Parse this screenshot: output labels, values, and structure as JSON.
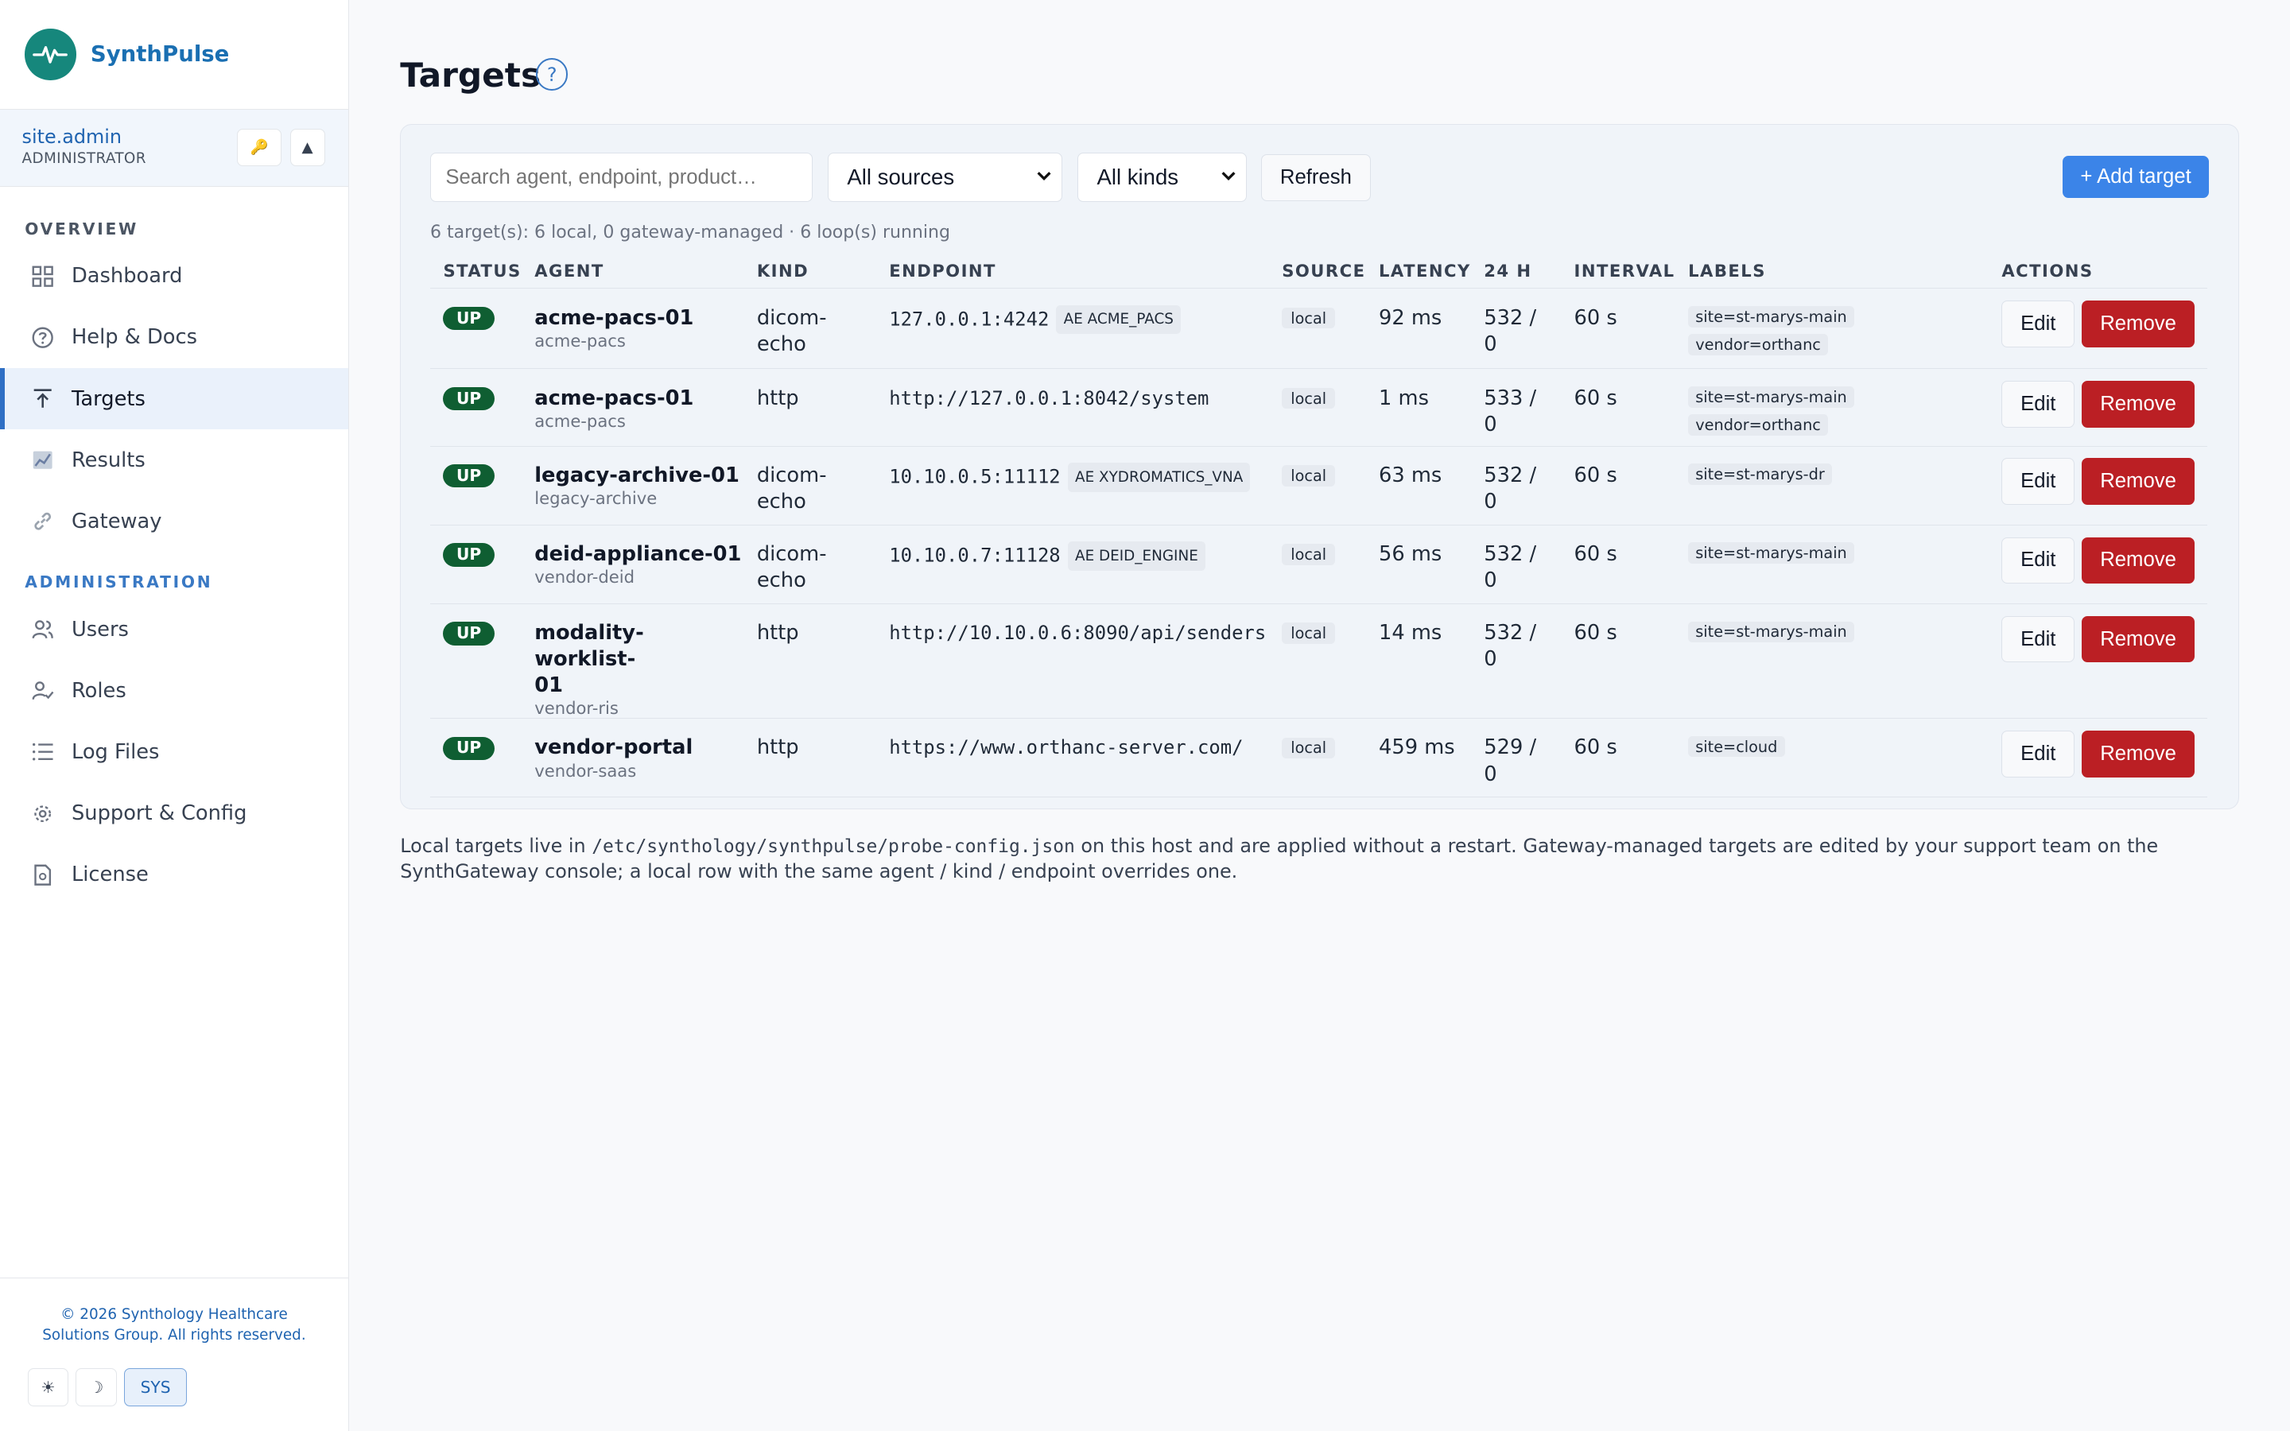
{
  "brand": {
    "name": "SynthPulse"
  },
  "user": {
    "name": "site.admin",
    "role": "ADMINISTRATOR",
    "key_icon": "🔑",
    "up_icon": "▲"
  },
  "nav": {
    "overview_label": "OVERVIEW",
    "admin_label": "ADMINISTRATION",
    "items": [
      {
        "label": "Dashboard",
        "icon": "grid-icon"
      },
      {
        "label": "Help & Docs",
        "icon": "help-circle-icon"
      },
      {
        "label": "Targets",
        "icon": "arrow-up-icon",
        "active": true
      },
      {
        "label": "Results",
        "icon": "chart-icon"
      },
      {
        "label": "Gateway",
        "icon": "link-icon"
      },
      {
        "label": "Users",
        "icon": "users-icon"
      },
      {
        "label": "Roles",
        "icon": "user-check-icon"
      },
      {
        "label": "Log Files",
        "icon": "list-icon"
      },
      {
        "label": "Support & Config",
        "icon": "settings-icon"
      },
      {
        "label": "License",
        "icon": "file-icon"
      }
    ]
  },
  "footer": {
    "copyright": "© 2026 Synthology Healthcare Solutions Group. All rights reserved.",
    "theme_light": "☀",
    "theme_dark": "☽",
    "theme_sys": "SYS"
  },
  "page": {
    "title": "Targets",
    "help": "?"
  },
  "toolbar": {
    "search_placeholder": "Search agent, endpoint, product…",
    "source_select": "All sources",
    "kind_select": "All kinds",
    "refresh_label": "Refresh",
    "add_label": "+ Add target"
  },
  "summary": "6 target(s): 6 local, 0 gateway-managed · 6 loop(s) running",
  "table": {
    "headers": [
      "STATUS",
      "AGENT",
      "KIND",
      "ENDPOINT",
      "SOURCE",
      "LATENCY",
      "24 H",
      "INTERVAL",
      "LABELS",
      "ACTIONS"
    ],
    "rows": [
      {
        "status": "UP",
        "agent": "acme-pacs-01",
        "product": "acme-pacs",
        "kind_1": "dicom-",
        "kind_2": "echo",
        "endpoint": "127.0.0.1:4242",
        "ae": "AE ACME_PACS",
        "source": "local",
        "latency": "92 ms",
        "h24_1": "532 /",
        "h24_2": "0",
        "interval": "60 s",
        "labels": [
          "site=st-marys-main",
          "vendor=orthanc"
        ]
      },
      {
        "status": "UP",
        "agent": "acme-pacs-01",
        "product": "acme-pacs",
        "kind_1": "http",
        "kind_2": "",
        "endpoint": "http://127.0.0.1:8042/system",
        "ae": "",
        "source": "local",
        "latency": "1 ms",
        "h24_1": "533 /",
        "h24_2": "0",
        "interval": "60 s",
        "labels": [
          "site=st-marys-main",
          "vendor=orthanc"
        ]
      },
      {
        "status": "UP",
        "agent": "legacy-archive-01",
        "product": "legacy-archive",
        "kind_1": "dicom-",
        "kind_2": "echo",
        "endpoint": "10.10.0.5:11112",
        "ae": "AE XYDROMATICS_VNA",
        "source": "local",
        "latency": "63 ms",
        "h24_1": "532 /",
        "h24_2": "0",
        "interval": "60 s",
        "labels": [
          "site=st-marys-dr"
        ]
      },
      {
        "status": "UP",
        "agent": "deid-appliance-01",
        "product": "vendor-deid",
        "kind_1": "dicom-",
        "kind_2": "echo",
        "endpoint": "10.10.0.7:11128",
        "ae": "AE DEID_ENGINE",
        "source": "local",
        "latency": "56 ms",
        "h24_1": "532 /",
        "h24_2": "0",
        "interval": "60 s",
        "labels": [
          "site=st-marys-main"
        ]
      },
      {
        "status": "UP",
        "agent_1": "modality-worklist-",
        "agent_2": "01",
        "product": "vendor-ris",
        "kind_1": "http",
        "kind_2": "",
        "endpoint": "http://10.10.0.6:8090/api/senders",
        "ae": "",
        "source": "local",
        "latency": "14 ms",
        "h24_1": "532 /",
        "h24_2": "0",
        "interval": "60 s",
        "labels": [
          "site=st-marys-main"
        ]
      },
      {
        "status": "UP",
        "agent": "vendor-portal",
        "product": "vendor-saas",
        "kind_1": "http",
        "kind_2": "",
        "endpoint": "https://www.orthanc-server.com/",
        "ae": "",
        "source": "local",
        "latency": "459 ms",
        "h24_1": "529 /",
        "h24_2": "0",
        "interval": "60 s",
        "labels": [
          "site=cloud"
        ]
      }
    ],
    "edit_label": "Edit",
    "remove_label": "Remove"
  },
  "footnote": {
    "part1": "Local targets live in ",
    "path": "/etc/synthology/synthpulse/probe-config.json",
    "part2": " on this host and are applied without a restart. Gateway-managed targets are edited by your support team on the SynthGateway console; a local row with the same agent / kind / endpoint overrides one."
  },
  "colors": {
    "accent": "#3b84e8",
    "brand": "#16877c",
    "danger": "#bb1f24",
    "success": "#0f5e32"
  }
}
